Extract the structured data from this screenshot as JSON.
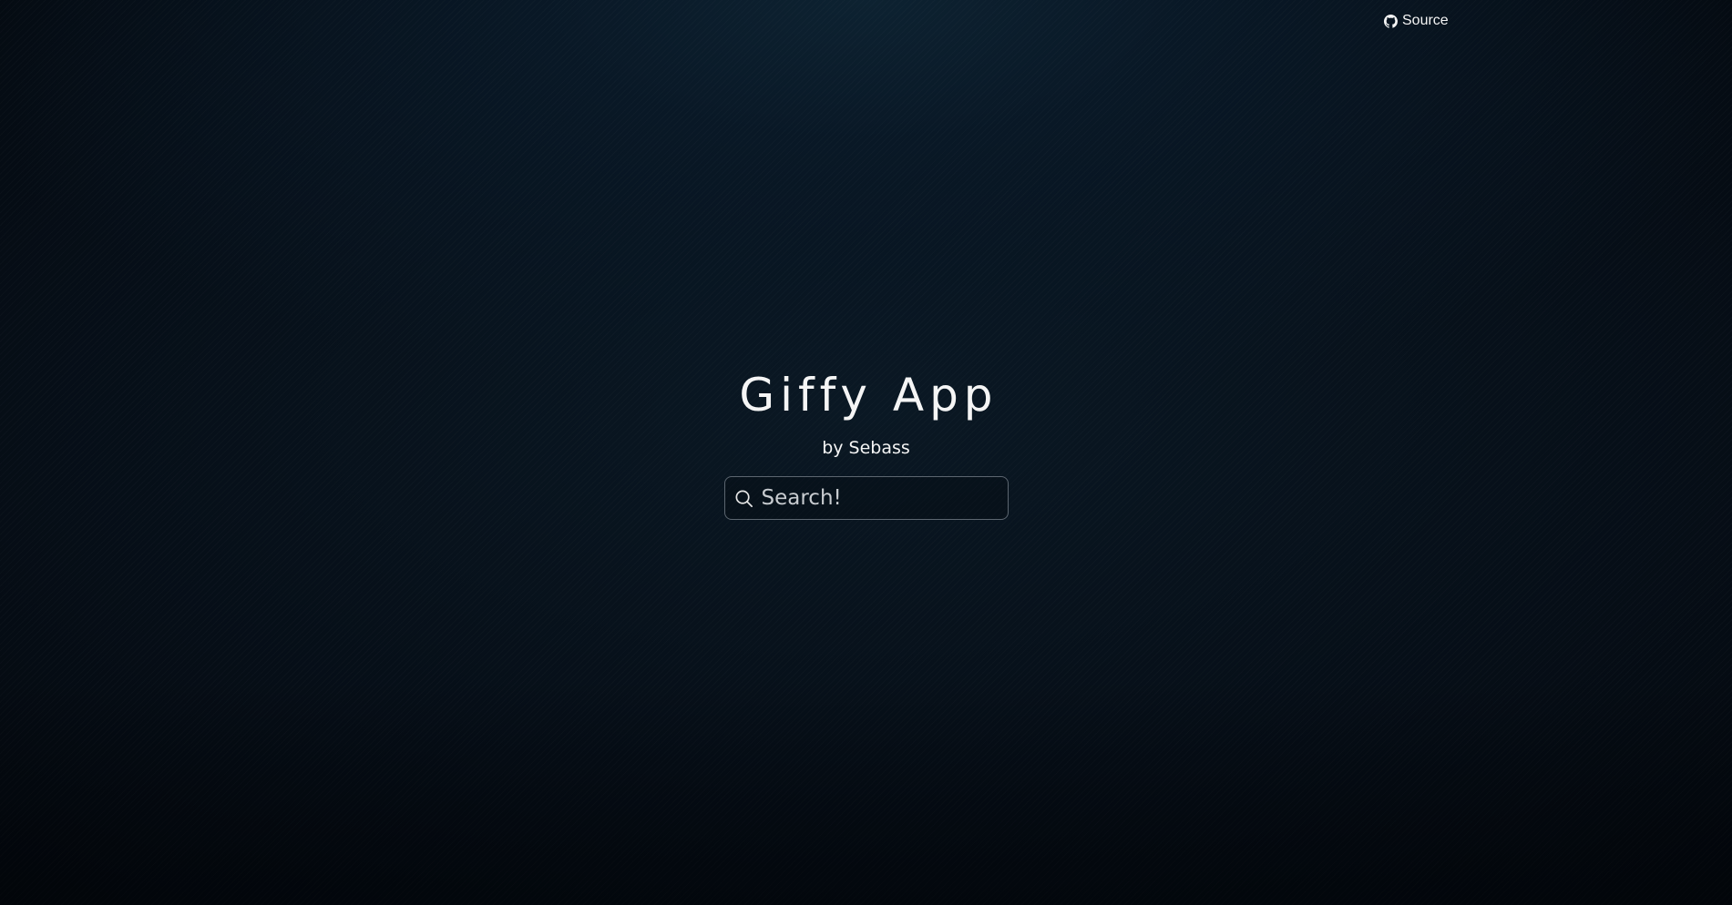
{
  "header": {
    "source_link": {
      "label": "Source",
      "icon": "github-icon"
    }
  },
  "hero": {
    "title": "Giffy App",
    "subtitle": "by Sebass"
  },
  "search": {
    "icon": "search-icon",
    "placeholder": "Search!",
    "value": ""
  },
  "colors": {
    "background": "#050b12",
    "text": "#f5f5f5",
    "search_border": "#5c6670"
  }
}
